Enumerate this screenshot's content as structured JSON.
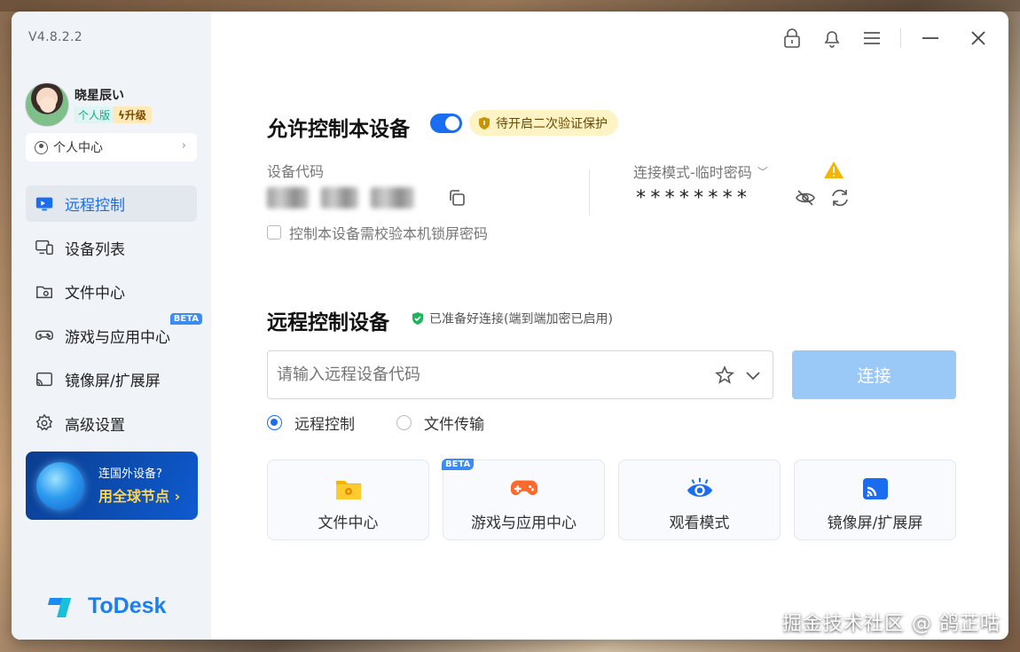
{
  "app": {
    "version": "V4.8.2.2",
    "brand": "ToDesk",
    "accent_color": "#1a6cf0"
  },
  "user": {
    "name": "晓星辰い",
    "plan_badge": "个人版",
    "upgrade_badge": "升级",
    "personal_center": "个人中心"
  },
  "sidebar": {
    "items": [
      {
        "label": "远程控制",
        "icon": "monitor-icon",
        "active": true
      },
      {
        "label": "设备列表",
        "icon": "devices-icon"
      },
      {
        "label": "文件中心",
        "icon": "folder-icon"
      },
      {
        "label": "游戏与应用中心",
        "icon": "gamepad-icon",
        "badge": "BETA"
      },
      {
        "label": "镜像屏/扩展屏",
        "icon": "cast-icon"
      },
      {
        "label": "高级设置",
        "icon": "gear-icon"
      }
    ],
    "promo": {
      "line1": "连国外设备?",
      "line2": "用全球节点 ›"
    }
  },
  "allow_control": {
    "title": "允许控制本设备",
    "toggle_on": true,
    "verify_badge": "待开启二次验证保护",
    "device_code_label": "设备代码",
    "lock_screen_checkbox": "控制本设备需校验本机锁屏密码",
    "connection_mode_label": "连接模式-临时密码",
    "password": "********"
  },
  "remote_control": {
    "title": "远程控制设备",
    "status": "已准备好连接(端到端加密已启用)",
    "input_placeholder": "请输入远程设备代码",
    "connect_button": "连接",
    "modes": [
      {
        "label": "远程控制",
        "selected": true
      },
      {
        "label": "文件传输",
        "selected": false
      }
    ],
    "quick_cards": [
      {
        "label": "文件中心",
        "icon": "folder-gear-icon"
      },
      {
        "label": "游戏与应用中心",
        "icon": "gamepad-icon",
        "badge": "BETA"
      },
      {
        "label": "观看模式",
        "icon": "eye-view-icon"
      },
      {
        "label": "镜像屏/扩展屏",
        "icon": "cast-icon"
      }
    ]
  },
  "watermark": "掘金技术社区 @ 鸽芷咕"
}
